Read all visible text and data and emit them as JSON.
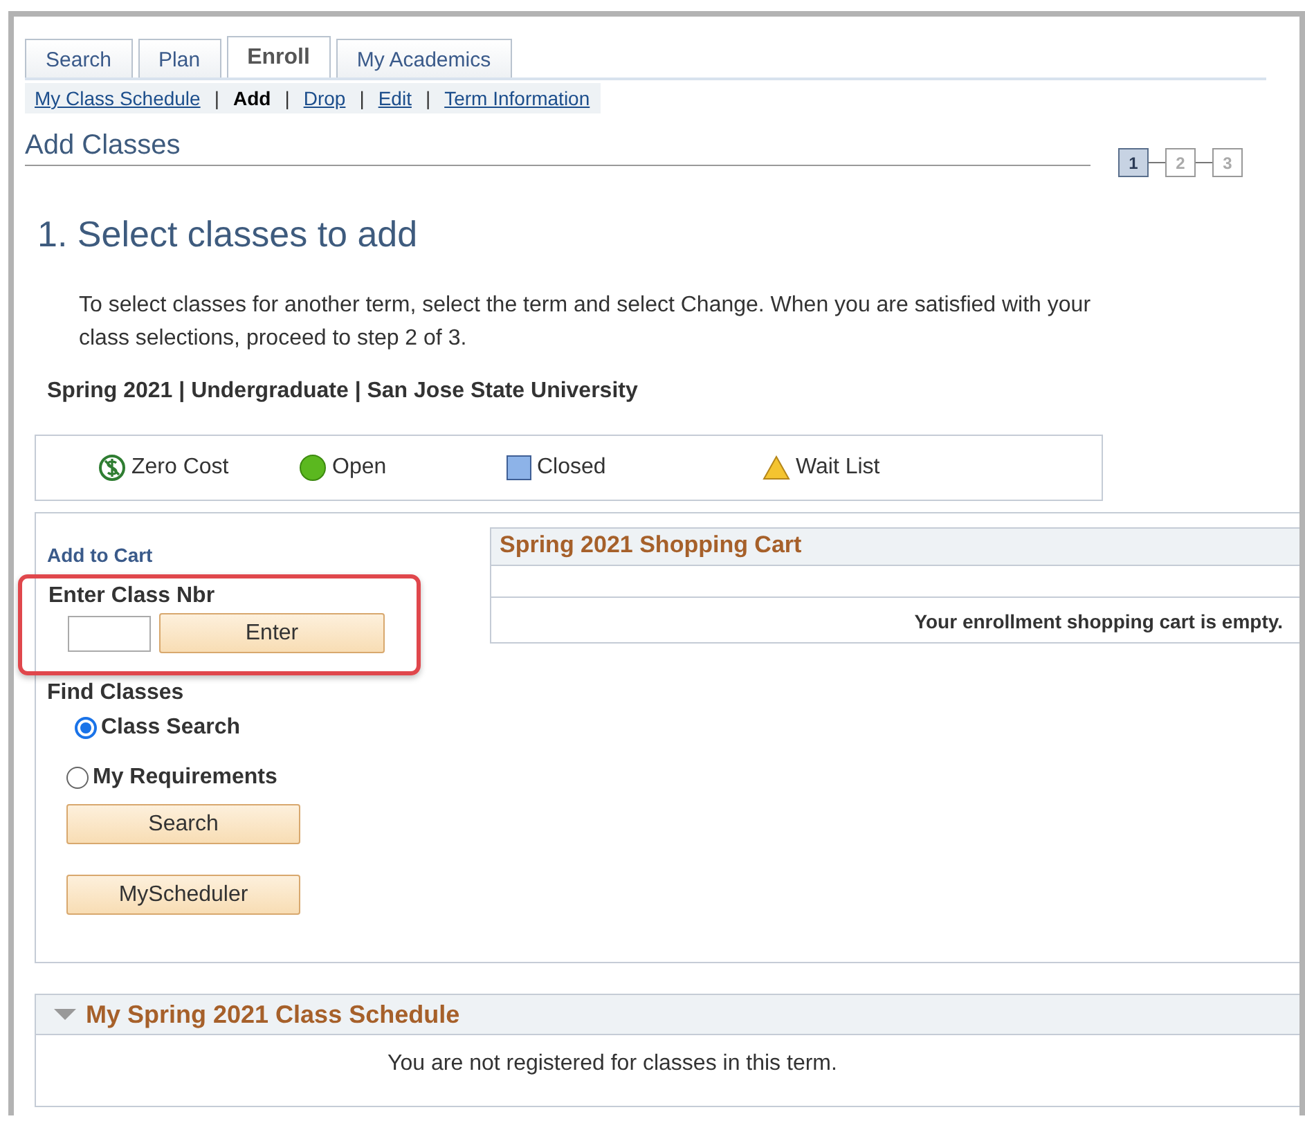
{
  "tabs": [
    {
      "label": "Search",
      "selected": false
    },
    {
      "label": "Plan",
      "selected": false
    },
    {
      "label": "Enroll",
      "selected": true
    },
    {
      "label": "My Academics",
      "selected": false
    }
  ],
  "subnav": [
    {
      "label": "My Class Schedule",
      "selected": false
    },
    {
      "label": "Add",
      "selected": true
    },
    {
      "label": "Drop",
      "selected": false
    },
    {
      "label": "Edit",
      "selected": false
    },
    {
      "label": "Term Information",
      "selected": false
    }
  ],
  "subnav_separator": "|",
  "page_title": "Add Classes",
  "steps": [
    {
      "label": "1",
      "selected": true
    },
    {
      "label": "2",
      "selected": false
    },
    {
      "label": "3",
      "selected": false
    }
  ],
  "heading": "1.  Select classes to add",
  "instructions": "To select classes for another term, select the term and select Change.  When you are satisfied with your class selections, proceed to step 2 of 3.",
  "term": "Spring 2021 | Undergraduate | San Jose State University",
  "legend": [
    {
      "kind": "zero-cost",
      "label": "Zero Cost"
    },
    {
      "kind": "open",
      "label": "Open"
    },
    {
      "kind": "closed",
      "label": "Closed"
    },
    {
      "kind": "waitlist",
      "label": "Wait List"
    }
  ],
  "add_to_cart": {
    "title": "Add to Cart",
    "field_label": "Enter Class Nbr",
    "button": "Enter",
    "highlighted": true
  },
  "find_classes": {
    "title": "Find Classes",
    "options": [
      {
        "label": "Class Search",
        "selected": true
      },
      {
        "label": "My Requirements",
        "selected": false
      }
    ],
    "buttons": [
      "Search",
      "MyScheduler"
    ]
  },
  "shopping_cart": {
    "title": "Spring 2021 Shopping Cart",
    "message": "Your enrollment shopping cart is empty."
  },
  "schedule": {
    "title": "My Spring 2021 Class Schedule",
    "expanded": true,
    "message": "You are not registered for classes in this term."
  }
}
